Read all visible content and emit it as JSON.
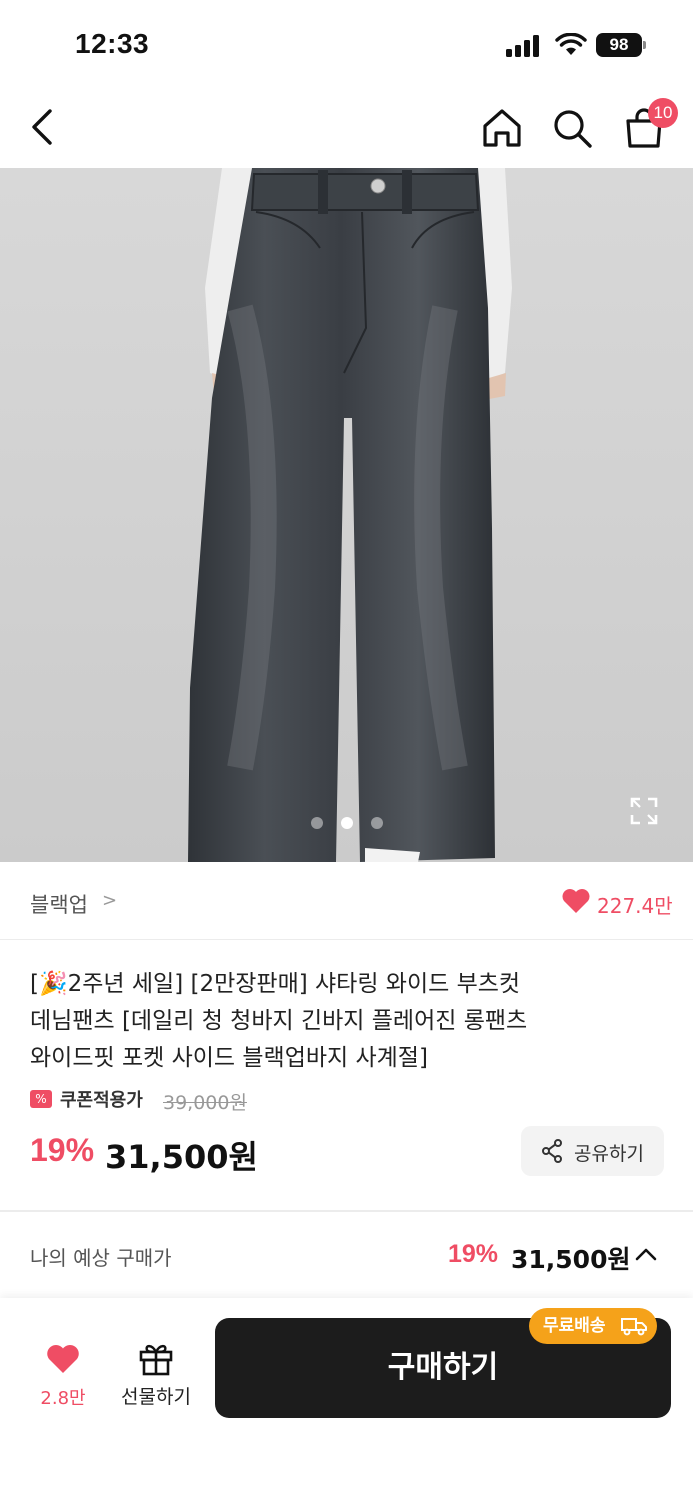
{
  "status_bar": {
    "time": "12:33",
    "battery": "98"
  },
  "nav": {
    "cart_count": "10",
    "icons": [
      "back-icon",
      "home-icon",
      "search-icon",
      "cart-icon"
    ]
  },
  "gallery": {
    "slide_count": 3,
    "active_slide": 2
  },
  "brand": {
    "name": "블랙업",
    "chevron": ">",
    "like_count": "227.4만"
  },
  "product": {
    "title_lines": [
      "[🎉2주년 세일] [2만장판매] 샤타링 와이드 부츠컷",
      "데님팬츠 [데일리 청 청바지 긴바지 플레어진 롱팬츠",
      "와이드핏 포켓 사이드 블랙업바지 사계절]"
    ],
    "coupon_label": "쿠폰적용가",
    "original_price": "39,000원",
    "discount": "19%",
    "price": "31,500원",
    "share_label": "공유하기"
  },
  "expected": {
    "label": "나의 예상 구매가",
    "discount": "19%",
    "price": "31,500원"
  },
  "bottom": {
    "wish_count": "2.8만",
    "gift_label": "선물하기",
    "buy_label": "구매하기",
    "free_shipping": "무료배송"
  },
  "colors": {
    "accent": "#ef4d64",
    "buy_button": "#1c1c1c",
    "free_ship_badge": "#f5a21a"
  }
}
